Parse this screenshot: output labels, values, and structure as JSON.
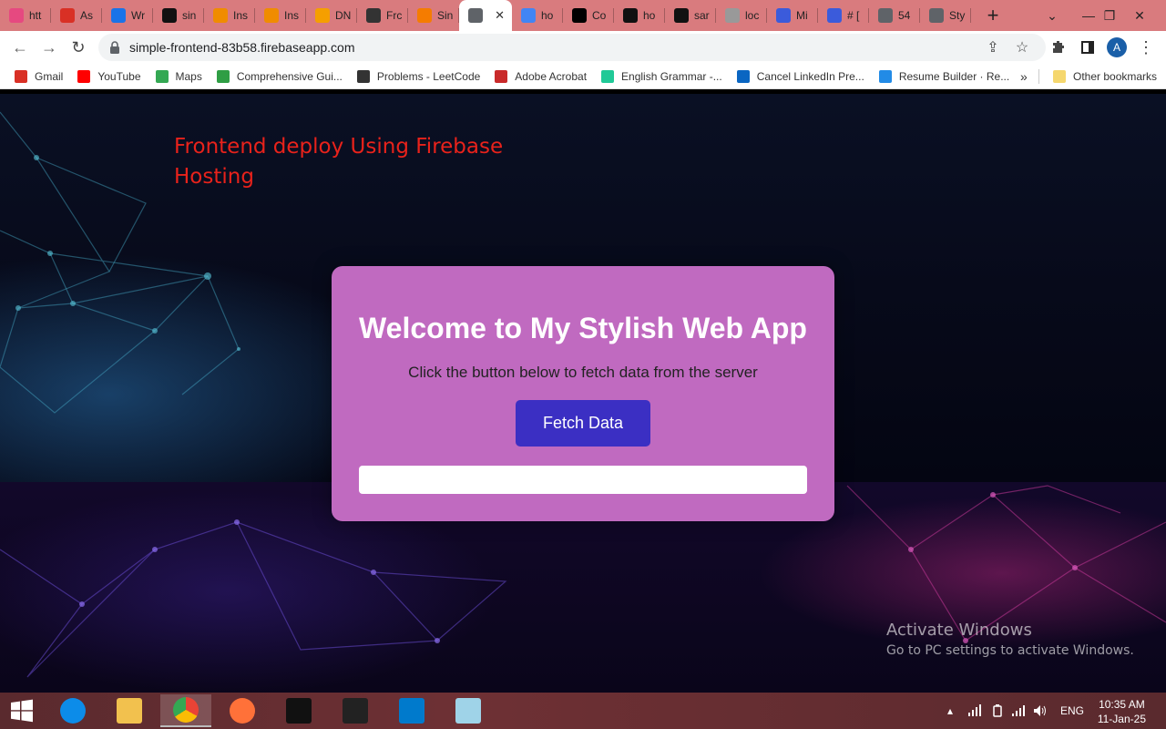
{
  "browser": {
    "tabs": [
      {
        "label": "htt",
        "icon": "pink-flower-icon",
        "color": "#e64980"
      },
      {
        "label": "As",
        "icon": "gmail-icon",
        "color": "#d93025"
      },
      {
        "label": "Wr",
        "icon": "diamond-icon",
        "color": "#1a73e8"
      },
      {
        "label": "sin",
        "icon": "github-icon",
        "color": "#111111"
      },
      {
        "label": "Ins",
        "icon": "orange-square-icon",
        "color": "#f08c00"
      },
      {
        "label": "Ins",
        "icon": "orange-square-icon",
        "color": "#f08c00"
      },
      {
        "label": "DN",
        "icon": "cloud-icon",
        "color": "#f59f00"
      },
      {
        "label": "Frc",
        "icon": "openai-icon",
        "color": "#333333"
      },
      {
        "label": "Sin",
        "icon": "firebase-icon",
        "color": "#f57c00"
      },
      {
        "label": "",
        "icon": "globe-icon",
        "color": "#5f6368",
        "active": true
      },
      {
        "label": "ho",
        "icon": "google-icon",
        "color": "#4285f4"
      },
      {
        "label": "Co",
        "icon": "ab-icon",
        "color": "#000000"
      },
      {
        "label": "ho",
        "icon": "dark-circle-icon",
        "color": "#111111"
      },
      {
        "label": "sar",
        "icon": "github-icon",
        "color": "#111111"
      },
      {
        "label": "loc",
        "icon": "grey-circle-icon",
        "color": "#999999"
      },
      {
        "label": "Mi",
        "icon": "app-blue-icon",
        "color": "#3b5bdb"
      },
      {
        "label": "# [",
        "icon": "app-blue-icon",
        "color": "#3b5bdb"
      },
      {
        "label": "54",
        "icon": "globe-icon",
        "color": "#5f6368"
      },
      {
        "label": "Sty",
        "icon": "globe-icon",
        "color": "#5f6368"
      }
    ],
    "new_tab_label": "+",
    "url": "simple-frontend-83b58.firebaseapp.com",
    "profile_initial": "A",
    "bookmarks": [
      {
        "label": "Gmail",
        "icon": "gmail-icon",
        "color": "#d93025"
      },
      {
        "label": "YouTube",
        "icon": "youtube-icon",
        "color": "#ff0000"
      },
      {
        "label": "Maps",
        "icon": "maps-pin-icon",
        "color": "#34a853"
      },
      {
        "label": "Comprehensive Gui...",
        "icon": "green-bolt-icon",
        "color": "#2f9e44"
      },
      {
        "label": "Problems - LeetCode",
        "icon": "leetcode-icon",
        "color": "#333333"
      },
      {
        "label": "Adobe Acrobat",
        "icon": "acrobat-icon",
        "color": "#c92a2a"
      },
      {
        "label": "English Grammar -...",
        "icon": "grammar-icon",
        "color": "#20c997"
      },
      {
        "label": "Cancel LinkedIn Pre...",
        "icon": "linkedin-icon",
        "color": "#0a66c2"
      },
      {
        "label": "Resume Builder · Re...",
        "icon": "resume-icon",
        "color": "#228be6"
      }
    ],
    "bookmarks_overflow": "»",
    "other_bookmarks": "Other bookmarks"
  },
  "page": {
    "title": "Frontend deploy Using Firebase Hosting",
    "card": {
      "heading": "Welcome to My Stylish Web App",
      "subtext": "Click the button below to fetch data from the server",
      "button_label": "Fetch Data",
      "result_text": ""
    }
  },
  "watermark": {
    "line1": "Activate Windows",
    "line2": "Go to PC settings to activate Windows."
  },
  "taskbar": {
    "apps": [
      {
        "name": "edge-icon",
        "color": "#0c8ce9"
      },
      {
        "name": "file-explorer-icon",
        "color": "#f2c14e"
      },
      {
        "name": "chrome-icon",
        "color": "#34a853",
        "active": true
      },
      {
        "name": "firefox-icon",
        "color": "#ff7139"
      },
      {
        "name": "cmd-icon",
        "color": "#111111"
      },
      {
        "name": "cmd-alt-icon",
        "color": "#222222"
      },
      {
        "name": "vscode-icon",
        "color": "#007acc"
      },
      {
        "name": "notepad-icon",
        "color": "#9fd3e8"
      }
    ],
    "lang": "ENG",
    "time": "10:35 AM",
    "date": "11-Jan-25"
  }
}
